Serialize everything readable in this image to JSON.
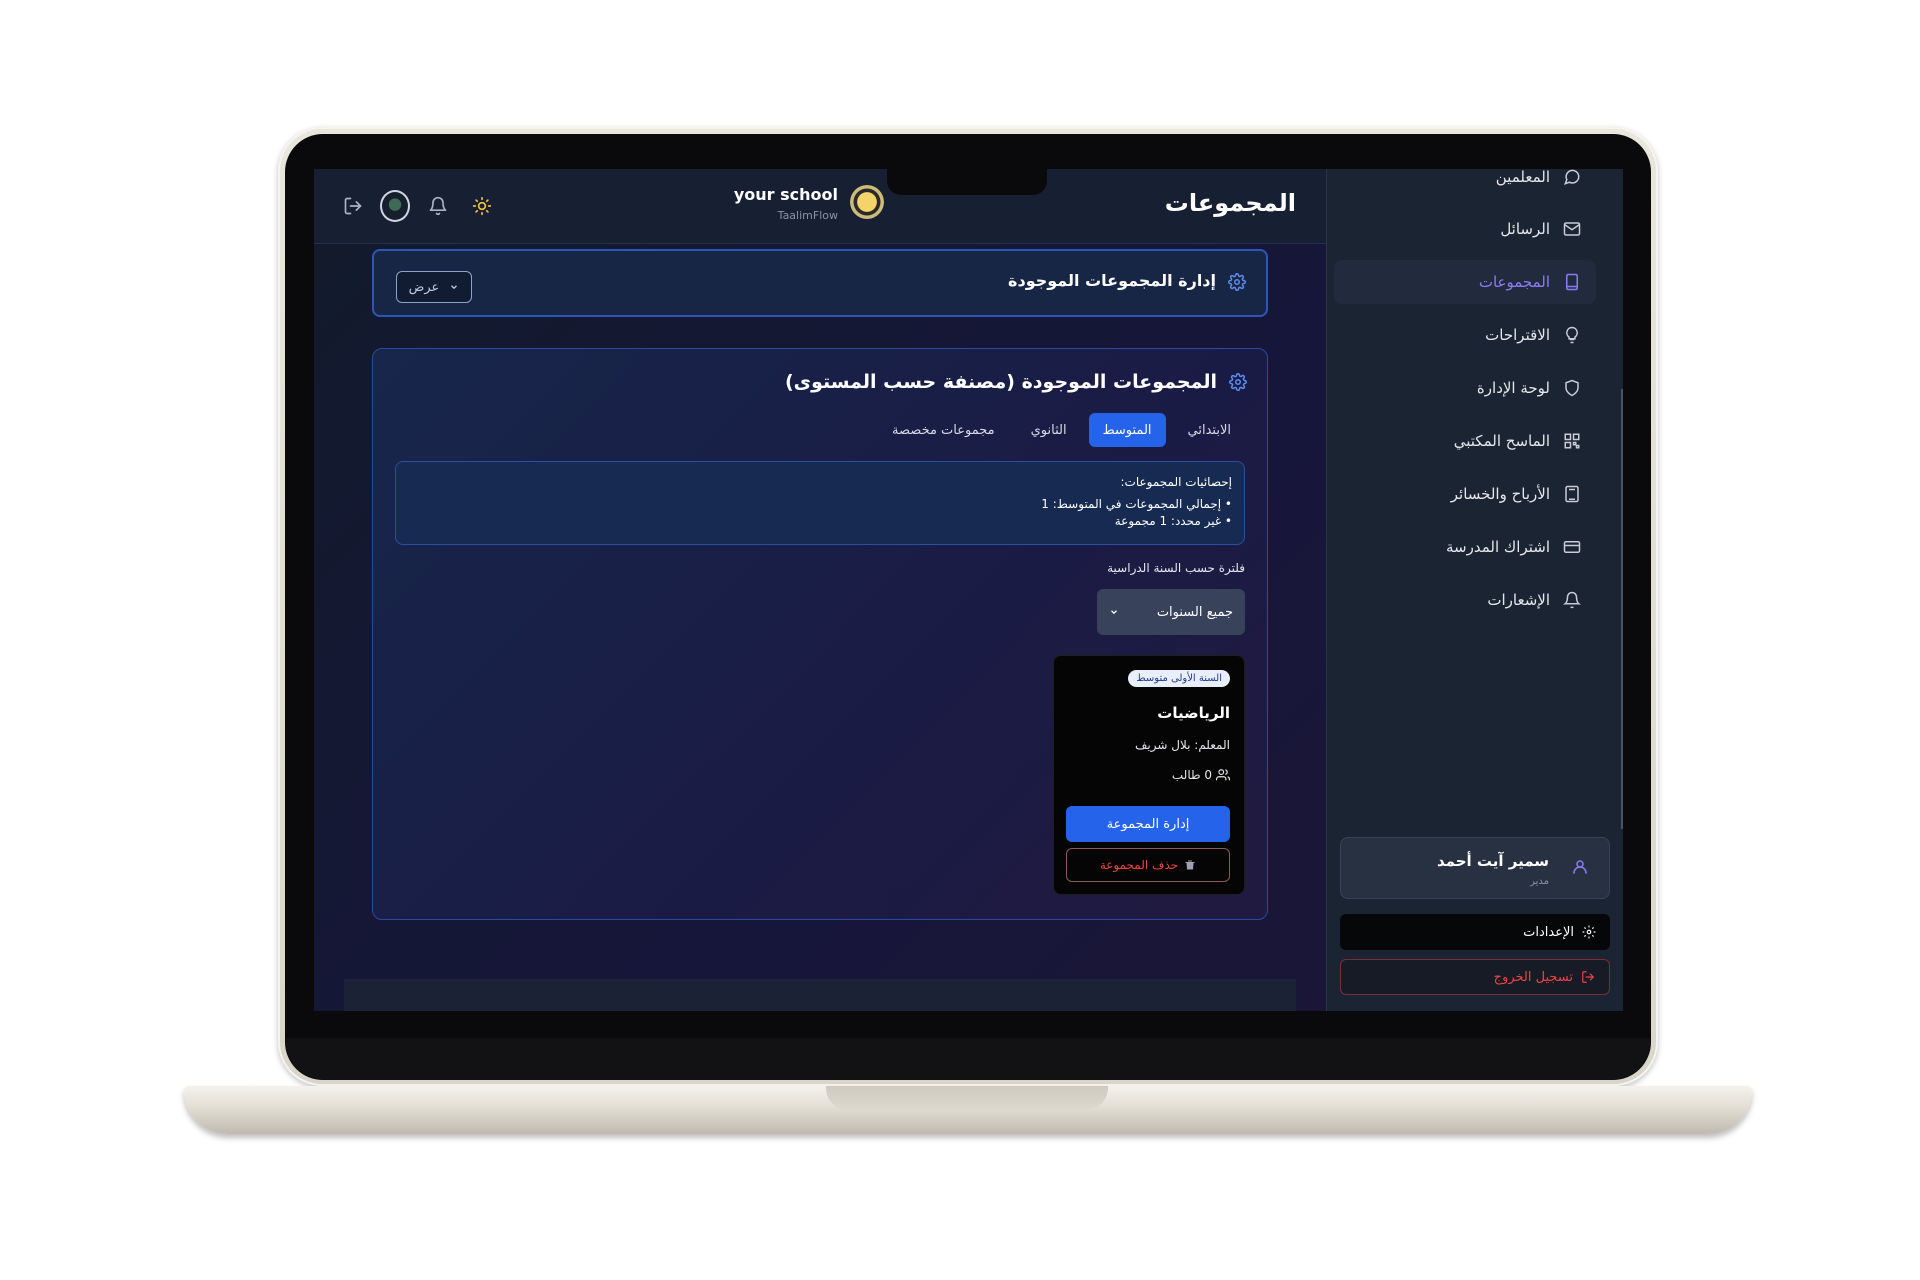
{
  "header": {
    "page_title": "المجموعات",
    "school_name": "your school",
    "school_subtitle": "TaalimFlow"
  },
  "manage_card": {
    "title": "إدارة المجموعات الموجودة",
    "view_button": "عرض"
  },
  "groups_card": {
    "title": "المجموعات الموجودة (مصنفة حسب المستوى)",
    "tabs": [
      {
        "label": "الابتدائي",
        "active": false
      },
      {
        "label": "المتوسط",
        "active": true
      },
      {
        "label": "الثانوي",
        "active": false
      },
      {
        "label": "مجموعات مخصصة",
        "active": false
      }
    ],
    "stats": {
      "heading": "إحصائيات المجموعات:",
      "lines": [
        "• إجمالي المجموعات في المتوسط: 1",
        "• غير محدد: 1 مجموعة"
      ]
    },
    "filter_label": "فلترة حسب السنة الدراسية",
    "year_select_value": "جميع السنوات",
    "group": {
      "badge": "السنة الأولى متوسط",
      "subject": "الرياضيات",
      "teacher": "المعلم: بلال شريف",
      "students": "0 طالب",
      "manage_button": "إدارة المجموعة",
      "delete_button": "حذف المجموعة"
    }
  },
  "sidebar": {
    "items": [
      {
        "label": "المعلمين",
        "icon": "chat-icon",
        "active": false
      },
      {
        "label": "الرسائل",
        "icon": "mail-icon",
        "active": false
      },
      {
        "label": "المجموعات",
        "icon": "book-icon",
        "active": true
      },
      {
        "label": "الاقتراحات",
        "icon": "lightbulb-icon",
        "active": false
      },
      {
        "label": "لوحة الإدارة",
        "icon": "shield-icon",
        "active": false
      },
      {
        "label": "الماسح المكتبي",
        "icon": "qr-code-icon",
        "active": false
      },
      {
        "label": "الأرباح والخسائر",
        "icon": "calculator-icon",
        "active": false
      },
      {
        "label": "اشتراك المدرسة",
        "icon": "credit-card-icon",
        "active": false
      },
      {
        "label": "الإشعارات",
        "icon": "bell-icon",
        "active": false
      }
    ],
    "user": {
      "name": "سمير آيت أحمد",
      "role": "مدير"
    },
    "settings_label": "الإعدادات",
    "logout_label": "تسجيل الخروج"
  },
  "colors": {
    "accent_blue": "#2563eb",
    "sidebar_active": "#8b7cf6",
    "danger": "#ef4444"
  }
}
